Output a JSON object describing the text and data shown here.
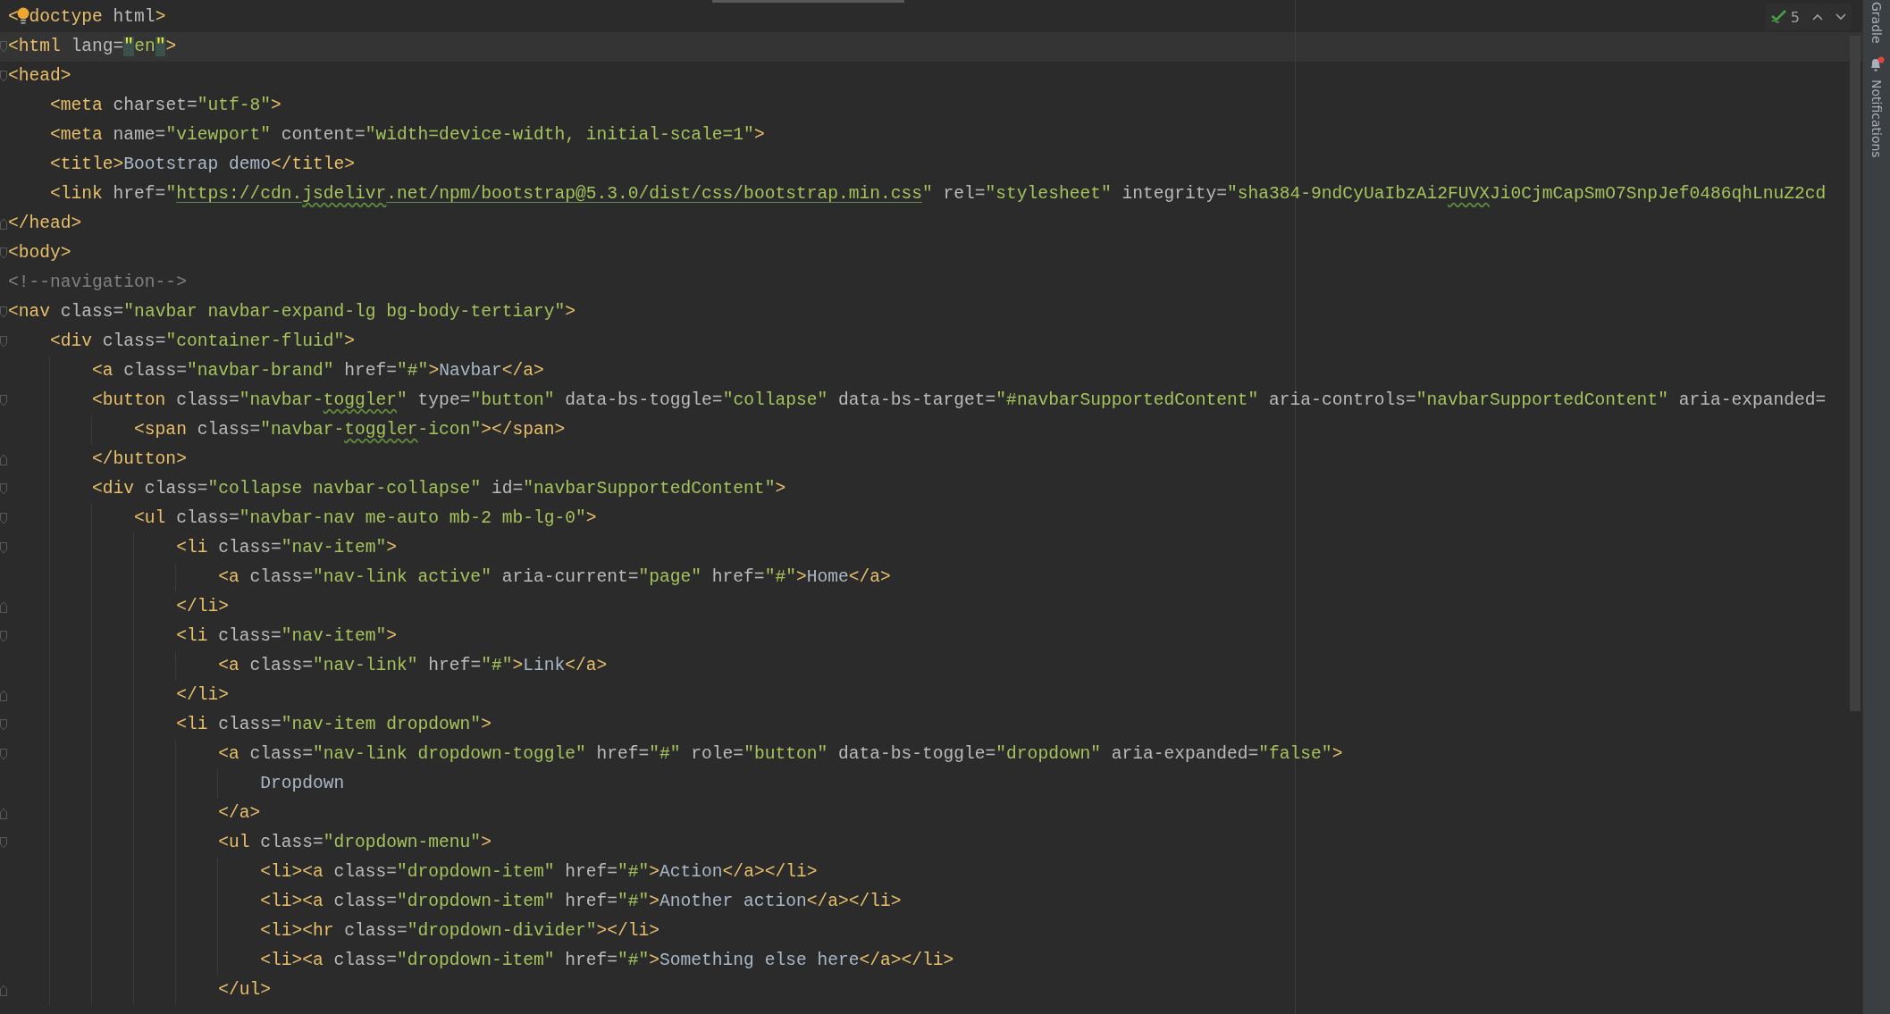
{
  "editor": {
    "inspection": {
      "count": "5"
    },
    "lines": [
      {
        "tokens": [
          {
            "kind": "tag",
            "text": "<"
          },
          {
            "kind": "bulb"
          },
          {
            "kind": "tag",
            "text": "doctype"
          },
          {
            "kind": "attr",
            "text": " html"
          },
          {
            "kind": "tag",
            "text": ">"
          }
        ]
      },
      {
        "current": true,
        "fold_start": true,
        "tokens": [
          {
            "kind": "tag",
            "text": "<html"
          },
          {
            "kind": "attr",
            "text": " lang="
          },
          {
            "kind": "value",
            "text": "\"",
            "matched": true
          },
          {
            "kind": "value",
            "text": "en"
          },
          {
            "kind": "value",
            "text": "\"",
            "matched": true
          },
          {
            "kind": "tag",
            "text": ">"
          }
        ]
      },
      {
        "fold_start": true,
        "tokens": [
          {
            "kind": "tag",
            "text": "<head>"
          }
        ],
        "children": [
          {
            "tokens": [
              {
                "kind": "tag",
                "text": "<meta"
              },
              {
                "kind": "attr",
                "text": " charset="
              },
              {
                "kind": "value",
                "text": "\"utf-8\""
              },
              {
                "kind": "tag",
                "text": ">"
              }
            ]
          },
          {
            "tokens": [
              {
                "kind": "tag",
                "text": "<meta"
              },
              {
                "kind": "attr",
                "text": " name="
              },
              {
                "kind": "value",
                "text": "\"viewport\""
              },
              {
                "kind": "attr",
                "text": " content="
              },
              {
                "kind": "value",
                "text": "\"width=device-width, initial-scale=1\""
              },
              {
                "kind": "tag",
                "text": ">"
              }
            ]
          },
          {
            "tokens": [
              {
                "kind": "tag",
                "text": "<title>"
              },
              {
                "kind": "text",
                "text": "Bootstrap demo"
              },
              {
                "kind": "tag",
                "text": "</title>"
              }
            ]
          },
          {
            "tokens": [
              {
                "kind": "tag",
                "text": "<link"
              },
              {
                "kind": "attr",
                "text": " href="
              },
              {
                "kind": "value",
                "text": "\""
              },
              {
                "kind": "url",
                "text": "https://cdn."
              },
              {
                "kind": "url",
                "text": "jsdelivr",
                "typo": true
              },
              {
                "kind": "url",
                "text": ".net/npm/bootstrap@5.3.0/dist/css/bootstrap.min.css"
              },
              {
                "kind": "value",
                "text": "\""
              },
              {
                "kind": "attr",
                "text": " rel="
              },
              {
                "kind": "value",
                "text": "\"stylesheet\""
              },
              {
                "kind": "attr",
                "text": " integrity="
              },
              {
                "kind": "value",
                "text": "\"sha384-9ndCyUaIbzAi2"
              },
              {
                "kind": "value",
                "text": "FUVX",
                "typo": true
              },
              {
                "kind": "value",
                "text": "Ji0CjmCapSmO7SnpJef0486qhLnuZ2cd"
              }
            ]
          }
        ]
      },
      {
        "fold_end": true,
        "tokens": [
          {
            "kind": "tag",
            "text": "</head>"
          }
        ]
      },
      {
        "fold_start": true,
        "tokens": [
          {
            "kind": "tag",
            "text": "<body>"
          }
        ]
      },
      {
        "tokens": [
          {
            "kind": "comment",
            "text": "<!--navigation-->"
          }
        ]
      },
      {
        "fold_start": true,
        "tokens": [
          {
            "kind": "tag",
            "text": "<nav"
          },
          {
            "kind": "attr",
            "text": " class="
          },
          {
            "kind": "value",
            "text": "\"navbar navbar-expand-lg bg-body-tertiary\""
          },
          {
            "kind": "tag",
            "text": ">"
          }
        ],
        "children": [
          {
            "fold_start": true,
            "tokens": [
              {
                "kind": "tag",
                "text": "<div"
              },
              {
                "kind": "attr",
                "text": " class="
              },
              {
                "kind": "value",
                "text": "\"container-fluid\""
              },
              {
                "kind": "tag",
                "text": ">"
              }
            ],
            "children": [
              {
                "tokens": [
                  {
                    "kind": "tag",
                    "text": "<a"
                  },
                  {
                    "kind": "attr",
                    "text": " class="
                  },
                  {
                    "kind": "value",
                    "text": "\"navbar-brand\""
                  },
                  {
                    "kind": "attr",
                    "text": " href="
                  },
                  {
                    "kind": "value",
                    "text": "\"#\""
                  },
                  {
                    "kind": "tag",
                    "text": ">"
                  },
                  {
                    "kind": "text",
                    "text": "Navbar"
                  },
                  {
                    "kind": "tag",
                    "text": "</a>"
                  }
                ]
              },
              {
                "fold_start": true,
                "tokens": [
                  {
                    "kind": "tag",
                    "text": "<button"
                  },
                  {
                    "kind": "attr",
                    "text": " class="
                  },
                  {
                    "kind": "value",
                    "text": "\"navbar-"
                  },
                  {
                    "kind": "value",
                    "text": "toggler",
                    "typo": true
                  },
                  {
                    "kind": "value",
                    "text": "\""
                  },
                  {
                    "kind": "attr",
                    "text": " type="
                  },
                  {
                    "kind": "value",
                    "text": "\"button\""
                  },
                  {
                    "kind": "attr",
                    "text": " data-bs-toggle="
                  },
                  {
                    "kind": "value",
                    "text": "\"collapse\""
                  },
                  {
                    "kind": "attr",
                    "text": " data-bs-target="
                  },
                  {
                    "kind": "value",
                    "text": "\"#navbarSupportedContent\""
                  },
                  {
                    "kind": "attr",
                    "text": " aria-controls="
                  },
                  {
                    "kind": "value",
                    "text": "\"navbarSupportedContent\""
                  },
                  {
                    "kind": "attr",
                    "text": " aria-expanded="
                  }
                ],
                "children": [
                  {
                    "tokens": [
                      {
                        "kind": "tag",
                        "text": "<span"
                      },
                      {
                        "kind": "attr",
                        "text": " class="
                      },
                      {
                        "kind": "value",
                        "text": "\"navbar-"
                      },
                      {
                        "kind": "value",
                        "text": "toggler",
                        "typo": true
                      },
                      {
                        "kind": "value",
                        "text": "-icon\""
                      },
                      {
                        "kind": "tag",
                        "text": "></span>"
                      }
                    ]
                  }
                ]
              },
              {
                "fold_end": true,
                "tokens": [
                  {
                    "kind": "tag",
                    "text": "</button>"
                  }
                ]
              },
              {
                "fold_start": true,
                "tokens": [
                  {
                    "kind": "tag",
                    "text": "<div"
                  },
                  {
                    "kind": "attr",
                    "text": " class="
                  },
                  {
                    "kind": "value",
                    "text": "\"collapse navbar-collapse\""
                  },
                  {
                    "kind": "attr",
                    "text": " id="
                  },
                  {
                    "kind": "value",
                    "text": "\"navbarSupportedContent\""
                  },
                  {
                    "kind": "tag",
                    "text": ">"
                  }
                ],
                "children": [
                  {
                    "fold_start": true,
                    "tokens": [
                      {
                        "kind": "tag",
                        "text": "<ul"
                      },
                      {
                        "kind": "attr",
                        "text": " class="
                      },
                      {
                        "kind": "value",
                        "text": "\"navbar-nav me-auto mb-2 mb-lg-0\""
                      },
                      {
                        "kind": "tag",
                        "text": ">"
                      }
                    ],
                    "children": [
                      {
                        "fold_start": true,
                        "tokens": [
                          {
                            "kind": "tag",
                            "text": "<li"
                          },
                          {
                            "kind": "attr",
                            "text": " class="
                          },
                          {
                            "kind": "value",
                            "text": "\"nav-item\""
                          },
                          {
                            "kind": "tag",
                            "text": ">"
                          }
                        ],
                        "children": [
                          {
                            "tokens": [
                              {
                                "kind": "tag",
                                "text": "<a"
                              },
                              {
                                "kind": "attr",
                                "text": " class="
                              },
                              {
                                "kind": "value",
                                "text": "\"nav-link active\""
                              },
                              {
                                "kind": "attr",
                                "text": " aria-current="
                              },
                              {
                                "kind": "value",
                                "text": "\"page\""
                              },
                              {
                                "kind": "attr",
                                "text": " href="
                              },
                              {
                                "kind": "value",
                                "text": "\"#\""
                              },
                              {
                                "kind": "tag",
                                "text": ">"
                              },
                              {
                                "kind": "text",
                                "text": "Home"
                              },
                              {
                                "kind": "tag",
                                "text": "</a>"
                              }
                            ]
                          }
                        ]
                      },
                      {
                        "fold_end": true,
                        "tokens": [
                          {
                            "kind": "tag",
                            "text": "</li>"
                          }
                        ]
                      },
                      {
                        "fold_start": true,
                        "tokens": [
                          {
                            "kind": "tag",
                            "text": "<li"
                          },
                          {
                            "kind": "attr",
                            "text": " class="
                          },
                          {
                            "kind": "value",
                            "text": "\"nav-item\""
                          },
                          {
                            "kind": "tag",
                            "text": ">"
                          }
                        ],
                        "children": [
                          {
                            "tokens": [
                              {
                                "kind": "tag",
                                "text": "<a"
                              },
                              {
                                "kind": "attr",
                                "text": " class="
                              },
                              {
                                "kind": "value",
                                "text": "\"nav-link\""
                              },
                              {
                                "kind": "attr",
                                "text": " href="
                              },
                              {
                                "kind": "value",
                                "text": "\"#\""
                              },
                              {
                                "kind": "tag",
                                "text": ">"
                              },
                              {
                                "kind": "text",
                                "text": "Link"
                              },
                              {
                                "kind": "tag",
                                "text": "</a>"
                              }
                            ]
                          }
                        ]
                      },
                      {
                        "fold_end": true,
                        "tokens": [
                          {
                            "kind": "tag",
                            "text": "</li>"
                          }
                        ]
                      },
                      {
                        "fold_start": true,
                        "tokens": [
                          {
                            "kind": "tag",
                            "text": "<li"
                          },
                          {
                            "kind": "attr",
                            "text": " class="
                          },
                          {
                            "kind": "value",
                            "text": "\"nav-item dropdown\""
                          },
                          {
                            "kind": "tag",
                            "text": ">"
                          }
                        ],
                        "children": [
                          {
                            "fold_start": true,
                            "tokens": [
                              {
                                "kind": "tag",
                                "text": "<a"
                              },
                              {
                                "kind": "attr",
                                "text": " class="
                              },
                              {
                                "kind": "value",
                                "text": "\"nav-link dropdown-toggle\""
                              },
                              {
                                "kind": "attr",
                                "text": " href="
                              },
                              {
                                "kind": "value",
                                "text": "\"#\""
                              },
                              {
                                "kind": "attr",
                                "text": " role="
                              },
                              {
                                "kind": "value",
                                "text": "\"button\""
                              },
                              {
                                "kind": "attr",
                                "text": " data-bs-toggle="
                              },
                              {
                                "kind": "value",
                                "text": "\"dropdown\""
                              },
                              {
                                "kind": "attr",
                                "text": " aria-expanded="
                              },
                              {
                                "kind": "value",
                                "text": "\"false\""
                              },
                              {
                                "kind": "tag",
                                "text": ">"
                              }
                            ],
                            "children": [
                              {
                                "tokens": [
                                  {
                                    "kind": "text",
                                    "text": "Dropdown"
                                  }
                                ]
                              }
                            ]
                          },
                          {
                            "fold_end": true,
                            "tokens": [
                              {
                                "kind": "tag",
                                "text": "</a>"
                              }
                            ]
                          },
                          {
                            "fold_start": true,
                            "tokens": [
                              {
                                "kind": "tag",
                                "text": "<ul"
                              },
                              {
                                "kind": "attr",
                                "text": " class="
                              },
                              {
                                "kind": "value",
                                "text": "\"dropdown-menu\""
                              },
                              {
                                "kind": "tag",
                                "text": ">"
                              }
                            ],
                            "children": [
                              {
                                "tokens": [
                                  {
                                    "kind": "tag",
                                    "text": "<li><a"
                                  },
                                  {
                                    "kind": "attr",
                                    "text": " class="
                                  },
                                  {
                                    "kind": "value",
                                    "text": "\"dropdown-item\""
                                  },
                                  {
                                    "kind": "attr",
                                    "text": " href="
                                  },
                                  {
                                    "kind": "value",
                                    "text": "\"#\""
                                  },
                                  {
                                    "kind": "tag",
                                    "text": ">"
                                  },
                                  {
                                    "kind": "text",
                                    "text": "Action"
                                  },
                                  {
                                    "kind": "tag",
                                    "text": "</a></li>"
                                  }
                                ]
                              },
                              {
                                "tokens": [
                                  {
                                    "kind": "tag",
                                    "text": "<li><a"
                                  },
                                  {
                                    "kind": "attr",
                                    "text": " class="
                                  },
                                  {
                                    "kind": "value",
                                    "text": "\"dropdown-item\""
                                  },
                                  {
                                    "kind": "attr",
                                    "text": " href="
                                  },
                                  {
                                    "kind": "value",
                                    "text": "\"#\""
                                  },
                                  {
                                    "kind": "tag",
                                    "text": ">"
                                  },
                                  {
                                    "kind": "text",
                                    "text": "Another action"
                                  },
                                  {
                                    "kind": "tag",
                                    "text": "</a></li>"
                                  }
                                ]
                              },
                              {
                                "tokens": [
                                  {
                                    "kind": "tag",
                                    "text": "<li><hr"
                                  },
                                  {
                                    "kind": "attr",
                                    "text": " class="
                                  },
                                  {
                                    "kind": "value",
                                    "text": "\"dropdown-divider\""
                                  },
                                  {
                                    "kind": "tag",
                                    "text": "></li>"
                                  }
                                ]
                              },
                              {
                                "tokens": [
                                  {
                                    "kind": "tag",
                                    "text": "<li><a"
                                  },
                                  {
                                    "kind": "attr",
                                    "text": " class="
                                  },
                                  {
                                    "kind": "value",
                                    "text": "\"dropdown-item\""
                                  },
                                  {
                                    "kind": "attr",
                                    "text": " href="
                                  },
                                  {
                                    "kind": "value",
                                    "text": "\"#\""
                                  },
                                  {
                                    "kind": "tag",
                                    "text": ">"
                                  },
                                  {
                                    "kind": "text",
                                    "text": "Something else here"
                                  },
                                  {
                                    "kind": "tag",
                                    "text": "</a></li>"
                                  }
                                ]
                              }
                            ]
                          },
                          {
                            "fold_end": true,
                            "tokens": [
                              {
                                "kind": "tag",
                                "text": "</ul>"
                              }
                            ]
                          }
                        ]
                      }
                    ]
                  }
                ]
              }
            ]
          }
        ]
      }
    ]
  },
  "tool_strip": [
    {
      "kind": "text",
      "label": "Gradle"
    },
    {
      "kind": "bell",
      "label": "Notifications",
      "alert": true
    }
  ]
}
